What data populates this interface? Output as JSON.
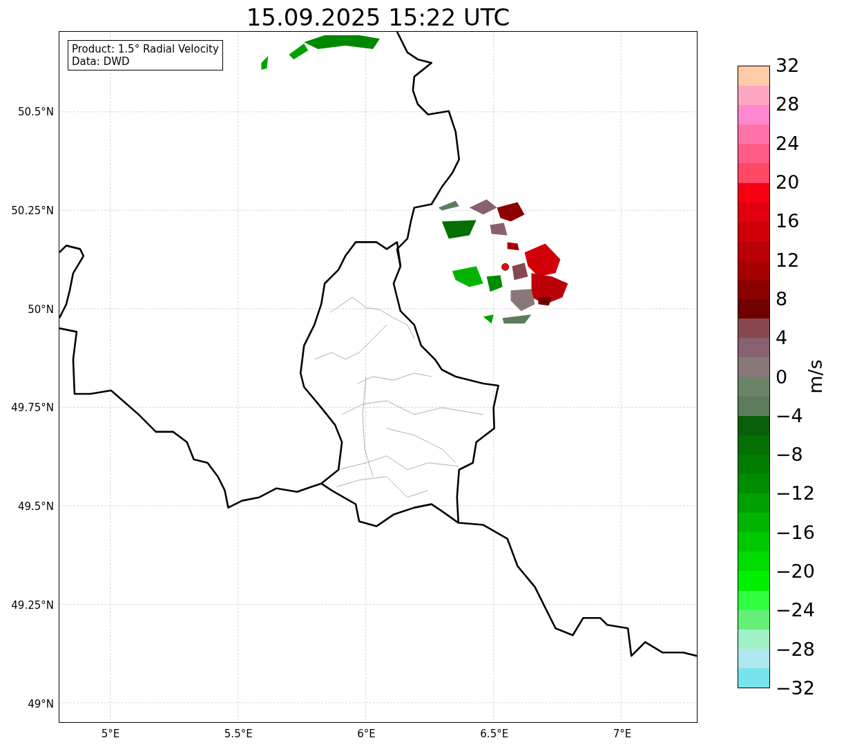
{
  "title": "15.09.2025 15:22 UTC",
  "info_box": [
    "Product: 1.5° Radial Velocity",
    "Data: DWD"
  ],
  "map": {
    "xticks": [
      "5°E",
      "5.5°E",
      "6°E",
      "6.5°E",
      "7°E"
    ],
    "yticks": [
      "50.5°N",
      "50.25°N",
      "50°N",
      "49.75°N",
      "49.5°N",
      "49.25°N",
      "49°N"
    ]
  },
  "colorbar": {
    "label": "m/s",
    "ticks": [
      "32",
      "28",
      "24",
      "20",
      "16",
      "12",
      "8",
      "4",
      "0",
      "−4",
      "−8",
      "−12",
      "−16",
      "−20",
      "−24",
      "−28",
      "−32"
    ],
    "bands": [
      {
        "color": "#ffcba8"
      },
      {
        "color": "#ffa8c4"
      },
      {
        "color": "#ff88d0"
      },
      {
        "color": "#ff74a8"
      },
      {
        "color": "#ff5c88"
      },
      {
        "color": "#ff4864"
      },
      {
        "color": "#f50010"
      },
      {
        "color": "#e00010"
      },
      {
        "color": "#d00008"
      },
      {
        "color": "#bc0008"
      },
      {
        "color": "#a80000"
      },
      {
        "color": "#8c0000"
      },
      {
        "color": "#700000"
      },
      {
        "color": "#884850"
      },
      {
        "color": "#886070"
      },
      {
        "color": "#887878"
      },
      {
        "color": "#6a8468"
      },
      {
        "color": "#5c7c5c"
      },
      {
        "color": "#086008"
      },
      {
        "color": "#047004"
      },
      {
        "color": "#007c00"
      },
      {
        "color": "#008c00"
      },
      {
        "color": "#00a000"
      },
      {
        "color": "#00b400"
      },
      {
        "color": "#00c800"
      },
      {
        "color": "#00dc00"
      },
      {
        "color": "#00f000"
      },
      {
        "color": "#30ff40"
      },
      {
        "color": "#64f078"
      },
      {
        "color": "#a0f0c8"
      },
      {
        "color": "#b0e8f0"
      },
      {
        "color": "#78e4ec"
      }
    ]
  }
}
